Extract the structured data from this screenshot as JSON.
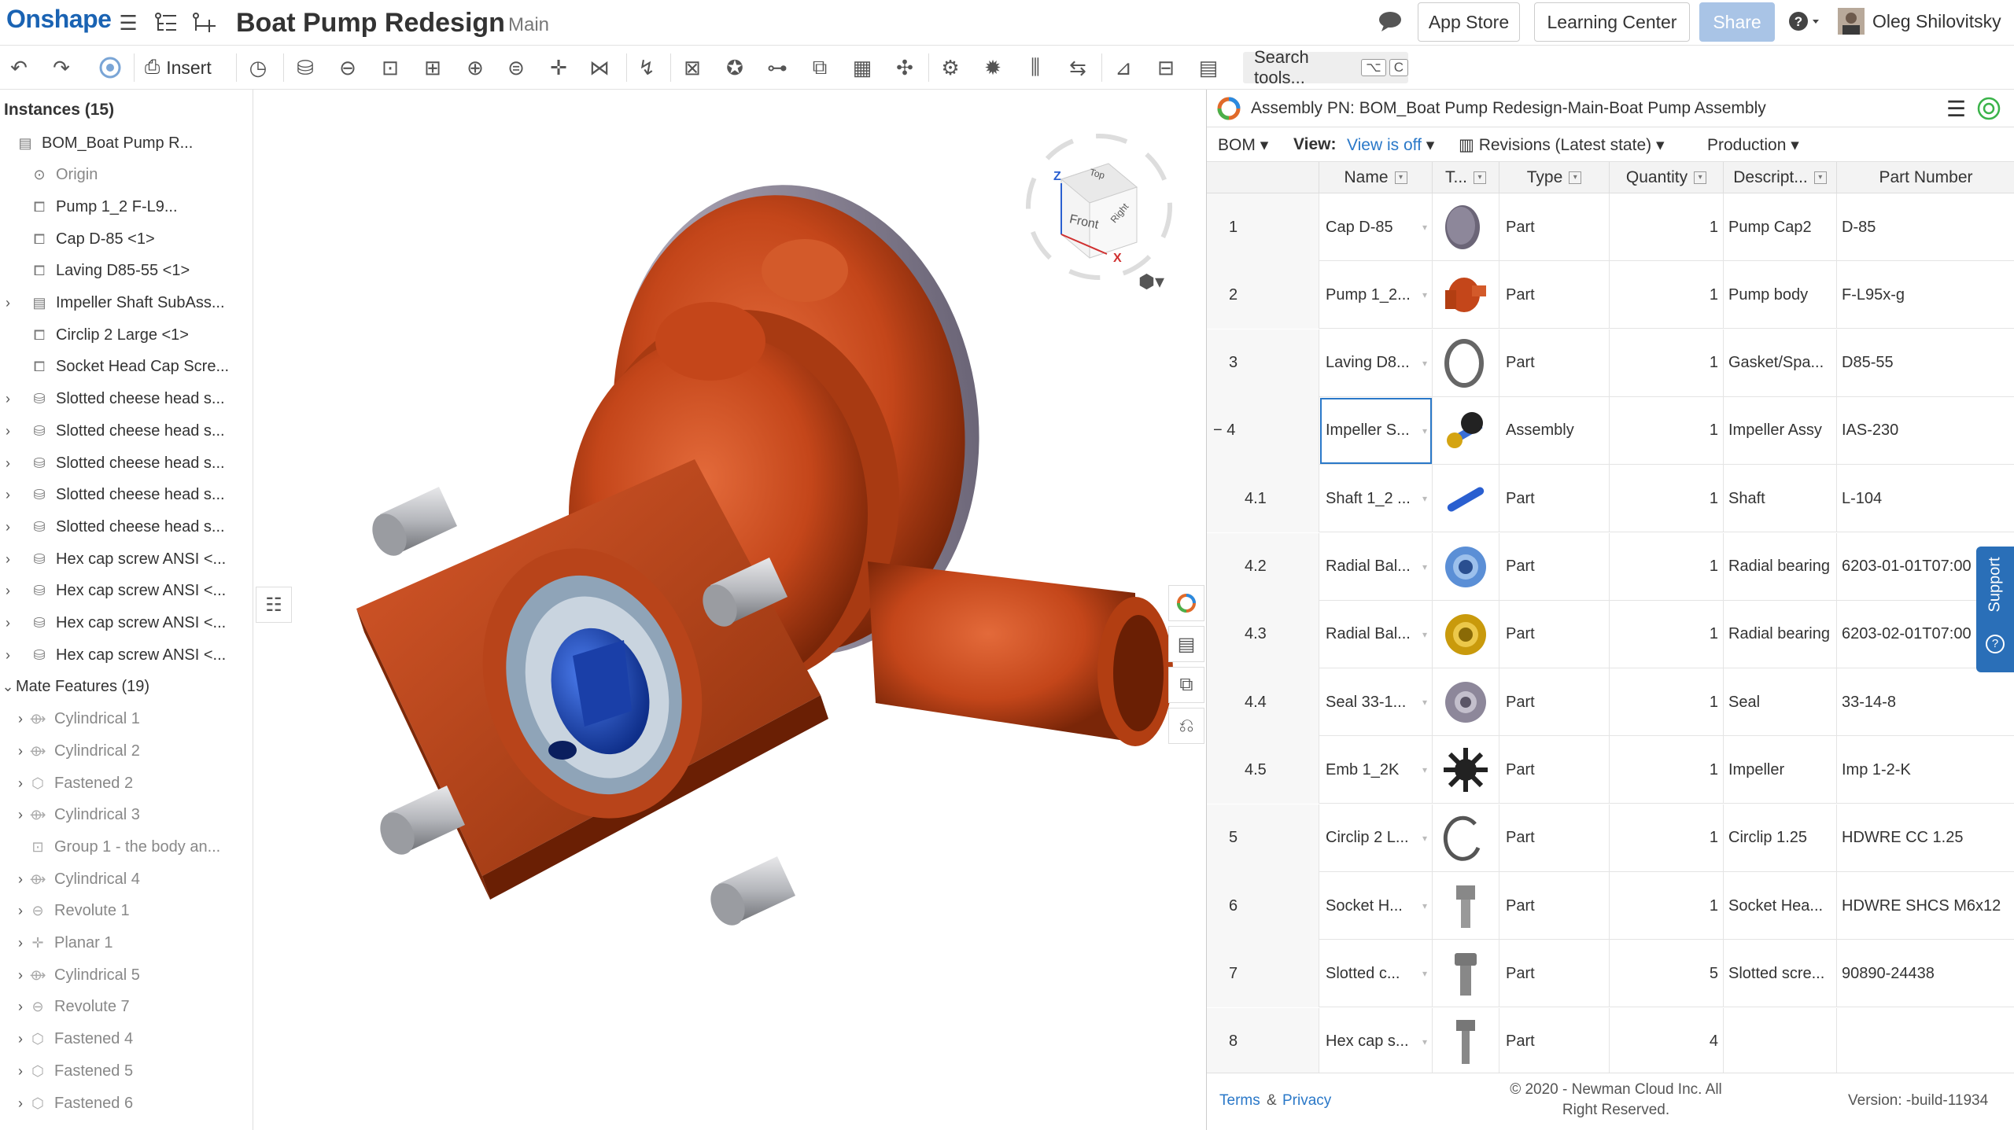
{
  "app": {
    "logo": "Onshape",
    "title": "Boat Pump Redesign",
    "branch": "Main"
  },
  "top_buttons": {
    "app_store": "App Store",
    "learning_center": "Learning Center",
    "share": "Share",
    "user": "Oleg Shilovitsky"
  },
  "toolbar": {
    "insert": "Insert",
    "search_placeholder": "Search tools...",
    "search_shortcut_1": "⌥",
    "search_shortcut_2": "C"
  },
  "instances": {
    "header": "Instances (15)",
    "items": [
      {
        "label": "BOM_Boat Pump R...",
        "icon": "assembly-icon",
        "indent": 0,
        "expand": ""
      },
      {
        "label": "Origin",
        "icon": "origin-icon",
        "indent": 1,
        "expand": "",
        "muted": true
      },
      {
        "label": "Pump 1_2 F-L9...",
        "icon": "part-icon",
        "indent": 1,
        "expand": ""
      },
      {
        "label": "Cap D-85 <1>",
        "icon": "part-icon",
        "indent": 1,
        "expand": ""
      },
      {
        "label": "Laving D85-55 <1>",
        "icon": "part-icon",
        "indent": 1,
        "expand": ""
      },
      {
        "label": "Impeller Shaft SubAss...",
        "icon": "assembly-icon",
        "indent": 1,
        "expand": "›"
      },
      {
        "label": "Circlip 2 Large <1>",
        "icon": "part-icon",
        "indent": 1,
        "expand": ""
      },
      {
        "label": "Socket Head Cap Scre...",
        "icon": "part-icon",
        "indent": 1,
        "expand": ""
      },
      {
        "label": "Slotted cheese head s...",
        "icon": "screw-icon",
        "indent": 1,
        "expand": "›"
      },
      {
        "label": "Slotted cheese head s...",
        "icon": "screw-icon",
        "indent": 1,
        "expand": "›"
      },
      {
        "label": "Slotted cheese head s...",
        "icon": "screw-icon",
        "indent": 1,
        "expand": "›"
      },
      {
        "label": "Slotted cheese head s...",
        "icon": "screw-icon",
        "indent": 1,
        "expand": "›"
      },
      {
        "label": "Slotted cheese head s...",
        "icon": "screw-icon",
        "indent": 1,
        "expand": "›"
      },
      {
        "label": "Hex cap screw ANSI <...",
        "icon": "screw-icon",
        "indent": 1,
        "expand": "›"
      },
      {
        "label": "Hex cap screw ANSI <...",
        "icon": "screw-icon",
        "indent": 1,
        "expand": "›"
      },
      {
        "label": "Hex cap screw ANSI <...",
        "icon": "screw-icon",
        "indent": 1,
        "expand": "›"
      },
      {
        "label": "Hex cap screw ANSI <...",
        "icon": "screw-icon",
        "indent": 1,
        "expand": "›"
      }
    ]
  },
  "mates": {
    "header": "Mate Features (19)",
    "items": [
      {
        "label": "Cylindrical 1",
        "icon": "cylindrical-mate-icon"
      },
      {
        "label": "Cylindrical 2",
        "icon": "cylindrical-mate-icon"
      },
      {
        "label": "Fastened 2",
        "icon": "fastened-mate-icon"
      },
      {
        "label": "Cylindrical 3",
        "icon": "cylindrical-mate-icon"
      },
      {
        "label": "Group 1 - the body an...",
        "icon": "group-icon",
        "noexpand": true
      },
      {
        "label": "Cylindrical 4",
        "icon": "cylindrical-mate-icon"
      },
      {
        "label": "Revolute 1",
        "icon": "revolute-mate-icon"
      },
      {
        "label": "Planar 1",
        "icon": "planar-mate-icon"
      },
      {
        "label": "Cylindrical 5",
        "icon": "cylindrical-mate-icon"
      },
      {
        "label": "Revolute 7",
        "icon": "revolute-mate-icon"
      },
      {
        "label": "Fastened 4",
        "icon": "fastened-mate-icon"
      },
      {
        "label": "Fastened 5",
        "icon": "fastened-mate-icon"
      },
      {
        "label": "Fastened 6",
        "icon": "fastened-mate-icon"
      }
    ]
  },
  "viewcube": {
    "top": "Top",
    "front": "Front",
    "right": "Right",
    "z": "Z",
    "x": "X"
  },
  "bom": {
    "title": "Assembly PN: BOM_Boat Pump Redesign-Main-Boat Pump Assembly",
    "bom_label": "BOM",
    "view_label": "View:",
    "view_value": "View is off",
    "revisions": "Revisions (Latest state)",
    "production": "Production",
    "columns": {
      "name": "Name",
      "thumb": "T...",
      "type": "Type",
      "quantity": "Quantity",
      "description": "Descript...",
      "part_number": "Part Number"
    },
    "rows": [
      {
        "item": "1",
        "name": "Cap D-85",
        "type": "Part",
        "qty": "1",
        "desc": "Pump Cap2",
        "pn": "D-85",
        "thumb": "cap"
      },
      {
        "item": "2",
        "name": "Pump 1_2...",
        "type": "Part",
        "qty": "1",
        "desc": "Pump body",
        "pn": "F-L95x-g",
        "thumb": "pump"
      },
      {
        "item": "3",
        "name": "Laving D8...",
        "type": "Part",
        "qty": "1",
        "desc": "Gasket/Spa...",
        "pn": "D85-55",
        "thumb": "gasket"
      },
      {
        "item": "− 4",
        "name": "Impeller S...",
        "type": "Assembly",
        "qty": "1",
        "desc": "Impeller Assy",
        "pn": "IAS-230",
        "thumb": "impeller-assy",
        "selected": true
      },
      {
        "item": "4.1",
        "name": "Shaft 1_2 ...",
        "type": "Part",
        "qty": "1",
        "desc": "Shaft",
        "pn": "L-104",
        "thumb": "shaft"
      },
      {
        "item": "4.2",
        "name": "Radial Bal...",
        "type": "Part",
        "qty": "1",
        "desc": "Radial bearing",
        "pn": "6203-01-01T07:00",
        "thumb": "bearing-blue"
      },
      {
        "item": "4.3",
        "name": "Radial Bal...",
        "type": "Part",
        "qty": "1",
        "desc": "Radial bearing",
        "pn": "6203-02-01T07:00",
        "thumb": "bearing-gold"
      },
      {
        "item": "4.4",
        "name": "Seal 33-1...",
        "type": "Part",
        "qty": "1",
        "desc": "Seal",
        "pn": "33-14-8",
        "thumb": "seal"
      },
      {
        "item": "4.5",
        "name": "Emb 1_2K",
        "type": "Part",
        "qty": "1",
        "desc": "Impeller",
        "pn": "Imp 1-2-K",
        "thumb": "impeller"
      },
      {
        "item": "5",
        "name": "Circlip 2 L...",
        "type": "Part",
        "qty": "1",
        "desc": "Circlip 1.25",
        "pn": "HDWRE CC 1.25",
        "thumb": "circlip"
      },
      {
        "item": "6",
        "name": "Socket H...",
        "type": "Part",
        "qty": "1",
        "desc": "Socket Hea...",
        "pn": "HDWRE SHCS M6x12",
        "thumb": "socket-screw"
      },
      {
        "item": "7",
        "name": "Slotted c...",
        "type": "Part",
        "qty": "5",
        "desc": "Slotted scre...",
        "pn": "90890-24438",
        "thumb": "slotted-screw"
      },
      {
        "item": "8",
        "name": "Hex cap s...",
        "type": "Part",
        "qty": "4",
        "desc": "",
        "pn": "",
        "thumb": "hex-screw"
      }
    ],
    "footer": {
      "terms": "Terms",
      "amp": "&",
      "privacy": "Privacy",
      "copyright_1": "© 2020 - Newman Cloud Inc. All",
      "copyright_2": "Right Reserved.",
      "version": "Version: -build-11934"
    }
  },
  "support": "Support",
  "colors": {
    "brand": "#1a63b3",
    "accent": "#2a78c8",
    "pump": "#c4461a",
    "impeller": "#1e4fc0"
  }
}
